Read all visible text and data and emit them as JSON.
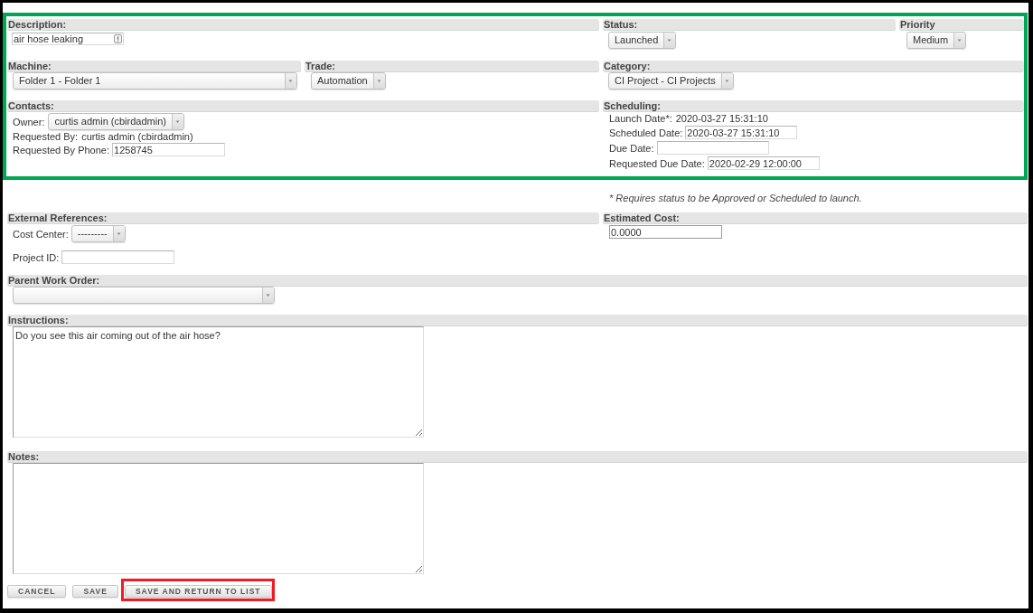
{
  "main_panel": {
    "highlighted": true,
    "description": {
      "title": "Description:",
      "value": "air hose leaking"
    },
    "status": {
      "title": "Status:",
      "value": "Launched"
    },
    "priority": {
      "title": "Priority",
      "value": "Medium"
    },
    "machine": {
      "title": "Machine:",
      "value": "Folder 1 - Folder 1"
    },
    "trade": {
      "title": "Trade:",
      "value": "Automation"
    },
    "category": {
      "title": "Category:",
      "value": "CI Project - CI Projects"
    },
    "contacts": {
      "title": "Contacts:",
      "owner": {
        "label": "Owner:",
        "value": "curtis admin (cbirdadmin)"
      },
      "requested_by": {
        "label": "Requested By:",
        "value": "curtis admin (cbirdadmin)"
      },
      "requested_by_phone": {
        "label": "Requested By Phone:",
        "value": "1258745"
      }
    },
    "scheduling": {
      "title": "Scheduling:",
      "launch_date": {
        "label": "Launch Date*:",
        "value": "2020-03-27 15:31:10"
      },
      "scheduled_date": {
        "label": "Scheduled Date:",
        "value": "2020-03-27 15:31:10"
      },
      "due_date": {
        "label": "Due Date:"
      },
      "requested_due_date": {
        "label": "Requested Due Date:",
        "value": "2020-02-29 12:00:00"
      }
    }
  },
  "launch_note": "* Requires status to be Approved or Scheduled to launch.",
  "external_references": {
    "title": "External References:",
    "cost_center": {
      "label": "Cost Center:",
      "value": "---------"
    },
    "project_id": {
      "label": "Project ID:"
    }
  },
  "estimated_cost": {
    "title": "Estimated Cost:",
    "value": "0.0000"
  },
  "parent_work_order": {
    "title": "Parent Work Order:"
  },
  "instructions": {
    "title": "Instructions:",
    "value": "Do you see this air coming out of the air hose?"
  },
  "notes": {
    "title": "Notes:"
  },
  "buttons": [
    {
      "label": "CANCEL",
      "highlighted": false
    },
    {
      "label": "SAVE",
      "highlighted": false
    },
    {
      "label": "SAVE AND RETURN TO LIST",
      "highlighted": true
    }
  ]
}
